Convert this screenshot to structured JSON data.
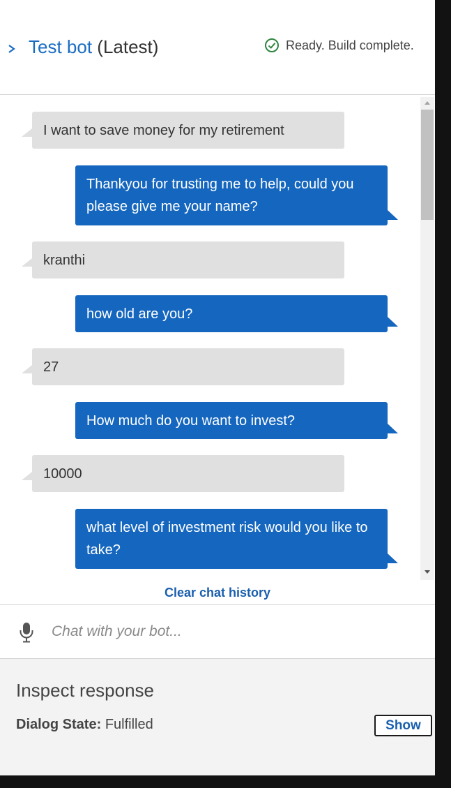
{
  "header": {
    "bot_name": "Test bot",
    "version": "(Latest)",
    "status": "Ready. Build complete.",
    "status_color": "#2e8540"
  },
  "chat": {
    "messages": [
      {
        "sender": "user",
        "text": "I want to save money for my retirement"
      },
      {
        "sender": "bot",
        "text": "Thankyou for trusting me to help, could you please give me your name?"
      },
      {
        "sender": "user",
        "text": "kranthi"
      },
      {
        "sender": "bot",
        "text": "how old are you?"
      },
      {
        "sender": "user",
        "text": "27"
      },
      {
        "sender": "bot",
        "text": "How much do you want to invest?"
      },
      {
        "sender": "user",
        "text": "10000"
      },
      {
        "sender": "bot",
        "text": "what level of investment risk would you like to take?"
      }
    ],
    "clear_label": "Clear chat history"
  },
  "input": {
    "placeholder": "Chat with your bot...",
    "value": ""
  },
  "inspect": {
    "title": "Inspect response",
    "dialog_state_label": "Dialog State:",
    "dialog_state_value": "Fulfilled",
    "show_label": "Show"
  },
  "icons": {
    "header_toggle": "chevron-right-icon",
    "status": "check-circle-icon",
    "mic": "microphone-icon"
  },
  "colors": {
    "accent": "#1a6cc2",
    "bot_bubble": "#1566be",
    "user_bubble": "#e0e0e0",
    "inspect_bg": "#f3f3f3"
  }
}
